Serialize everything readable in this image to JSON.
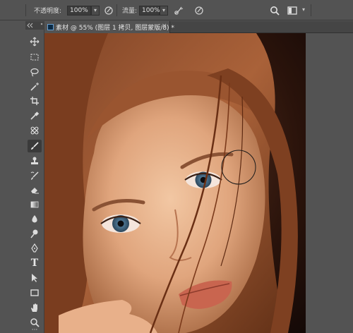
{
  "options_bar": {
    "opacity_label": "不透明度:",
    "opacity_value": "100%",
    "flow_label": "流量:",
    "flow_value": "100%",
    "icons": [
      "pressure-opacity-icon",
      "airbrush-icon",
      "pressure-size-icon",
      "search-icon",
      "workspace-icon"
    ]
  },
  "document": {
    "tab_title": "素材 @ 55% (图层 1 拷贝, 图层蒙版/8) *",
    "close_symbol": "×"
  },
  "tools": [
    {
      "name": "move-tool",
      "icon": "move-icon"
    },
    {
      "name": "marquee-tool",
      "icon": "rect-marquee-icon"
    },
    {
      "name": "lasso-tool",
      "icon": "lasso-icon"
    },
    {
      "name": "magic-wand-tool",
      "icon": "magic-wand-icon"
    },
    {
      "name": "crop-tool",
      "icon": "crop-icon"
    },
    {
      "name": "eyedropper-tool",
      "icon": "eyedropper-icon"
    },
    {
      "name": "healing-tool",
      "icon": "healing-icon"
    },
    {
      "name": "brush-tool",
      "icon": "brush-icon",
      "active": true
    },
    {
      "name": "stamp-tool",
      "icon": "stamp-icon"
    },
    {
      "name": "history-brush-tool",
      "icon": "history-brush-icon"
    },
    {
      "name": "eraser-tool",
      "icon": "eraser-icon"
    },
    {
      "name": "gradient-tool",
      "icon": "gradient-icon"
    },
    {
      "name": "blur-tool",
      "icon": "blur-icon"
    },
    {
      "name": "dodge-tool",
      "icon": "dodge-icon"
    },
    {
      "name": "pen-tool",
      "icon": "pen-icon"
    },
    {
      "name": "type-tool",
      "icon": "type-icon",
      "glyph": "T"
    },
    {
      "name": "path-select-tool",
      "icon": "path-select-icon"
    },
    {
      "name": "shape-tool",
      "icon": "rectangle-icon"
    },
    {
      "name": "hand-tool",
      "icon": "hand-icon"
    },
    {
      "name": "zoom-tool",
      "icon": "zoom-icon"
    },
    {
      "name": "more-tools",
      "icon": "ellipsis-icon",
      "glyph": "···"
    }
  ],
  "colors": {
    "ui_bg": "#535353",
    "field_bg": "#3b3b3b",
    "canvas_bg": "#1a0f0b"
  }
}
